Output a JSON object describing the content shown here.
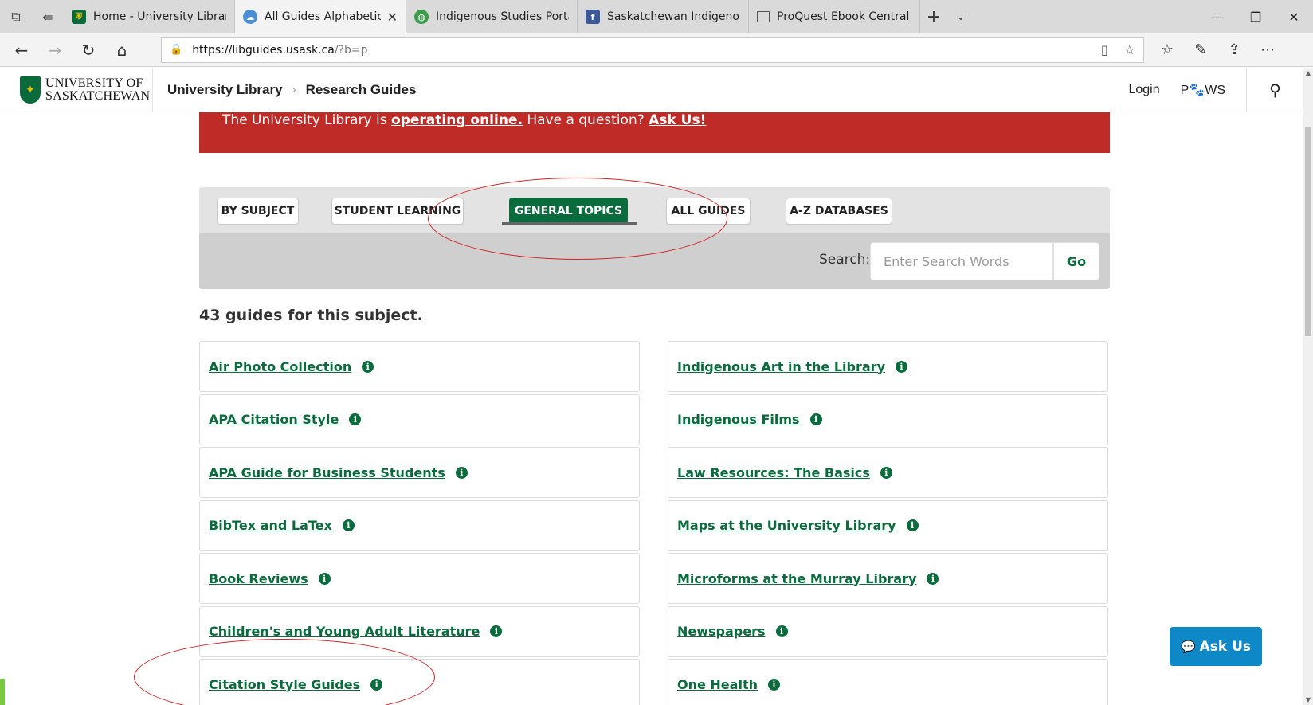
{
  "browser": {
    "tabs": [
      {
        "title": "Home - University Library -",
        "icon": "shield-icon",
        "active": false
      },
      {
        "title": "All Guides Alphabeticall",
        "icon": "cloud-icon",
        "active": true
      },
      {
        "title": "Indigenous Studies Portal ::",
        "icon": "globe-icon",
        "active": false
      },
      {
        "title": "Saskatchewan Indigenous N",
        "icon": "facebook-icon",
        "active": false
      },
      {
        "title": "ProQuest Ebook Central",
        "icon": "page-icon",
        "active": false
      }
    ],
    "url_host": "https://libguides.usask.ca",
    "url_rest": "/?b=p"
  },
  "header": {
    "logo_line1": "UNIVERSITY OF",
    "logo_line2": "SASKATCHEWAN",
    "breadcrumb": [
      "University Library",
      "Research Guides"
    ],
    "login_label": "Login",
    "paws_label": "P🐾WS"
  },
  "banner": {
    "text_before": "The University Library is ",
    "link1": "operating online.",
    "text_middle": " Have a question? ",
    "link2": "Ask Us!",
    "color": "#bf2b27"
  },
  "tabs": [
    {
      "label": "BY SUBJECT",
      "active": false
    },
    {
      "label": "STUDENT LEARNING",
      "active": false
    },
    {
      "label": "GENERAL TOPICS",
      "active": true
    },
    {
      "label": "ALL GUIDES",
      "active": false
    },
    {
      "label": "A-Z DATABASES",
      "active": false
    }
  ],
  "search": {
    "label": "Search:",
    "placeholder": "Enter Search Words",
    "go_label": "Go"
  },
  "guide_count": "43 guides for this subject.",
  "guides_left": [
    "Air Photo Collection",
    "APA Citation Style",
    "APA Guide for Business Students",
    "BibTex and LaTex",
    "Book Reviews",
    "Children's and Young Adult Literature",
    "Citation Style Guides"
  ],
  "guides_right": [
    "Indigenous Art in the Library",
    "Indigenous Films",
    "Law Resources: The Basics",
    "Maps at the University Library",
    "Microforms at the Murray Library",
    "Newspapers",
    "One Health"
  ],
  "info_glyph": "i",
  "ask_us_label": "Ask Us",
  "colors": {
    "brand_green": "#0a6b3d",
    "ask_blue": "#0e88c6",
    "annotation_red": "#d21f1f"
  }
}
